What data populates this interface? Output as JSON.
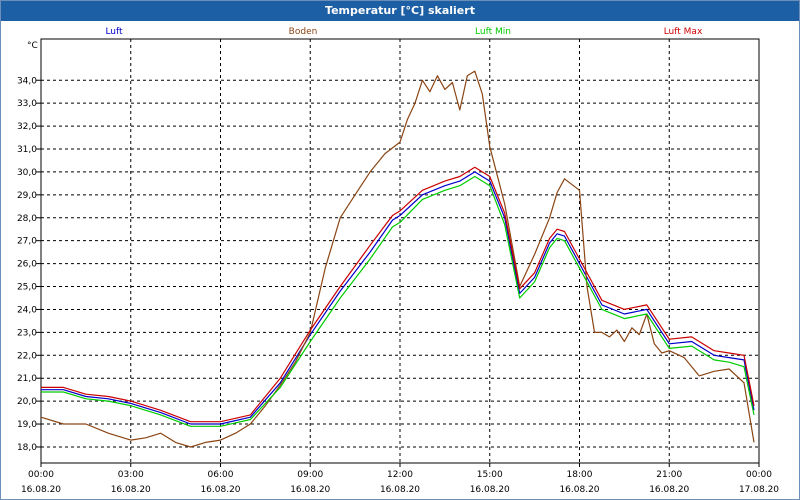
{
  "window": {
    "title": "Temperatur [°C] skaliert"
  },
  "chart_data": {
    "type": "line",
    "title": "Temperatur [°C] skaliert",
    "ylabel": "°C",
    "ylim": [
      17.3,
      35.8
    ],
    "xlim": [
      "2020-08-16 00:00",
      "2020-08-17 00:00"
    ],
    "grid": true,
    "legend_position": "top",
    "y_ticks": [
      "18,0",
      "19,0",
      "20,0",
      "21,0",
      "22,0",
      "23,0",
      "24,0",
      "25,0",
      "26,0",
      "27,0",
      "28,0",
      "29,0",
      "30,0",
      "31,0",
      "32,0",
      "33,0",
      "34,0"
    ],
    "x_ticks": [
      {
        "time": "00:00",
        "date": "16.08.20"
      },
      {
        "time": "03:00",
        "date": "16.08.20"
      },
      {
        "time": "06:00",
        "date": "16.08.20"
      },
      {
        "time": "09:00",
        "date": "16.08.20"
      },
      {
        "time": "12:00",
        "date": "16.08.20"
      },
      {
        "time": "15:00",
        "date": "16.08.20"
      },
      {
        "time": "18:00",
        "date": "16.08.20"
      },
      {
        "time": "21:00",
        "date": "16.08.20"
      },
      {
        "time": "00:00",
        "date": "17.08.20"
      }
    ],
    "series": [
      {
        "name": "Luft",
        "color": "#0000cc",
        "x": [
          "00:00",
          "00:45",
          "01:30",
          "02:15",
          "03:00",
          "04:00",
          "05:00",
          "06:00",
          "07:00",
          "08:00",
          "09:00",
          "10:00",
          "11:00",
          "11:45",
          "12:00",
          "12:45",
          "13:30",
          "14:00",
          "14:30",
          "15:00",
          "15:30",
          "16:00",
          "16:30",
          "17:00",
          "17:15",
          "17:30",
          "18:00",
          "18:45",
          "19:30",
          "20:15",
          "21:00",
          "21:45",
          "22:30",
          "23:00",
          "23:30",
          "23:50"
        ],
        "y": [
          20.5,
          20.5,
          20.2,
          20.1,
          19.9,
          19.5,
          19.0,
          19.0,
          19.3,
          20.8,
          22.9,
          24.8,
          26.5,
          27.9,
          28.1,
          29.0,
          29.4,
          29.6,
          30.0,
          29.6,
          28.0,
          24.7,
          25.4,
          26.9,
          27.3,
          27.2,
          26.0,
          24.2,
          23.8,
          24.0,
          22.5,
          22.6,
          22.0,
          21.9,
          21.8,
          19.6
        ]
      },
      {
        "name": "Boden",
        "color": "#8b4513",
        "x": [
          "00:00",
          "00:45",
          "01:30",
          "02:15",
          "03:00",
          "03:30",
          "04:00",
          "04:30",
          "05:00",
          "05:30",
          "06:00",
          "06:30",
          "07:00",
          "07:30",
          "08:00",
          "08:30",
          "09:00",
          "09:30",
          "10:00",
          "10:30",
          "11:00",
          "11:30",
          "12:00",
          "12:15",
          "12:30",
          "12:45",
          "13:00",
          "13:15",
          "13:30",
          "13:45",
          "14:00",
          "14:15",
          "14:30",
          "14:45",
          "15:00",
          "15:30",
          "16:00",
          "16:30",
          "17:00",
          "17:15",
          "17:30",
          "18:00",
          "18:15",
          "18:30",
          "18:45",
          "19:00",
          "19:15",
          "19:30",
          "19:45",
          "20:00",
          "20:15",
          "20:30",
          "20:45",
          "21:00",
          "21:30",
          "22:00",
          "22:30",
          "23:00",
          "23:30",
          "23:50"
        ],
        "y": [
          19.3,
          19.0,
          19.0,
          18.6,
          18.3,
          18.4,
          18.6,
          18.2,
          18.0,
          18.2,
          18.3,
          18.6,
          19.0,
          19.8,
          20.7,
          21.7,
          23.0,
          25.8,
          28.0,
          29.0,
          30.0,
          30.8,
          31.3,
          32.3,
          33.0,
          34.0,
          33.5,
          34.2,
          33.6,
          33.9,
          32.7,
          34.2,
          34.4,
          33.4,
          31.1,
          28.6,
          25.0,
          26.4,
          28.0,
          29.1,
          29.7,
          29.2,
          25.0,
          23.0,
          23.0,
          22.8,
          23.1,
          22.6,
          23.2,
          22.9,
          23.8,
          22.5,
          22.1,
          22.2,
          21.9,
          21.1,
          21.3,
          21.4,
          20.8,
          18.2
        ]
      },
      {
        "name": "Luft Min",
        "color": "#00cc00",
        "x": [
          "00:00",
          "00:45",
          "01:30",
          "02:15",
          "03:00",
          "04:00",
          "05:00",
          "06:00",
          "07:00",
          "08:00",
          "09:00",
          "10:00",
          "11:00",
          "11:45",
          "12:00",
          "12:45",
          "13:30",
          "14:00",
          "14:30",
          "15:00",
          "15:30",
          "16:00",
          "16:30",
          "17:00",
          "17:15",
          "17:30",
          "18:00",
          "18:45",
          "19:30",
          "20:15",
          "21:00",
          "21:45",
          "22:30",
          "23:00",
          "23:30",
          "23:50"
        ],
        "y": [
          20.4,
          20.4,
          20.1,
          20.0,
          19.8,
          19.4,
          18.9,
          18.9,
          19.2,
          20.6,
          22.6,
          24.5,
          26.2,
          27.6,
          27.8,
          28.8,
          29.2,
          29.4,
          29.8,
          29.4,
          27.7,
          24.5,
          25.2,
          26.7,
          27.1,
          27.0,
          25.8,
          24.0,
          23.6,
          23.8,
          22.3,
          22.4,
          21.8,
          21.7,
          21.5,
          19.4
        ]
      },
      {
        "name": "Luft Max",
        "color": "#cc0000",
        "x": [
          "00:00",
          "00:45",
          "01:30",
          "02:15",
          "03:00",
          "04:00",
          "05:00",
          "06:00",
          "07:00",
          "08:00",
          "09:00",
          "10:00",
          "11:00",
          "11:45",
          "12:00",
          "12:45",
          "13:30",
          "14:00",
          "14:30",
          "15:00",
          "15:30",
          "16:00",
          "16:30",
          "17:00",
          "17:15",
          "17:30",
          "18:00",
          "18:45",
          "19:30",
          "20:15",
          "21:00",
          "21:45",
          "22:30",
          "23:00",
          "23:30",
          "23:50"
        ],
        "y": [
          20.6,
          20.6,
          20.3,
          20.2,
          20.0,
          19.6,
          19.1,
          19.1,
          19.4,
          21.0,
          23.1,
          25.0,
          26.8,
          28.1,
          28.3,
          29.2,
          29.6,
          29.8,
          30.2,
          29.8,
          28.2,
          24.9,
          25.6,
          27.1,
          27.5,
          27.4,
          26.2,
          24.4,
          24.0,
          24.2,
          22.7,
          22.8,
          22.2,
          22.1,
          22.0,
          19.8
        ]
      }
    ]
  }
}
